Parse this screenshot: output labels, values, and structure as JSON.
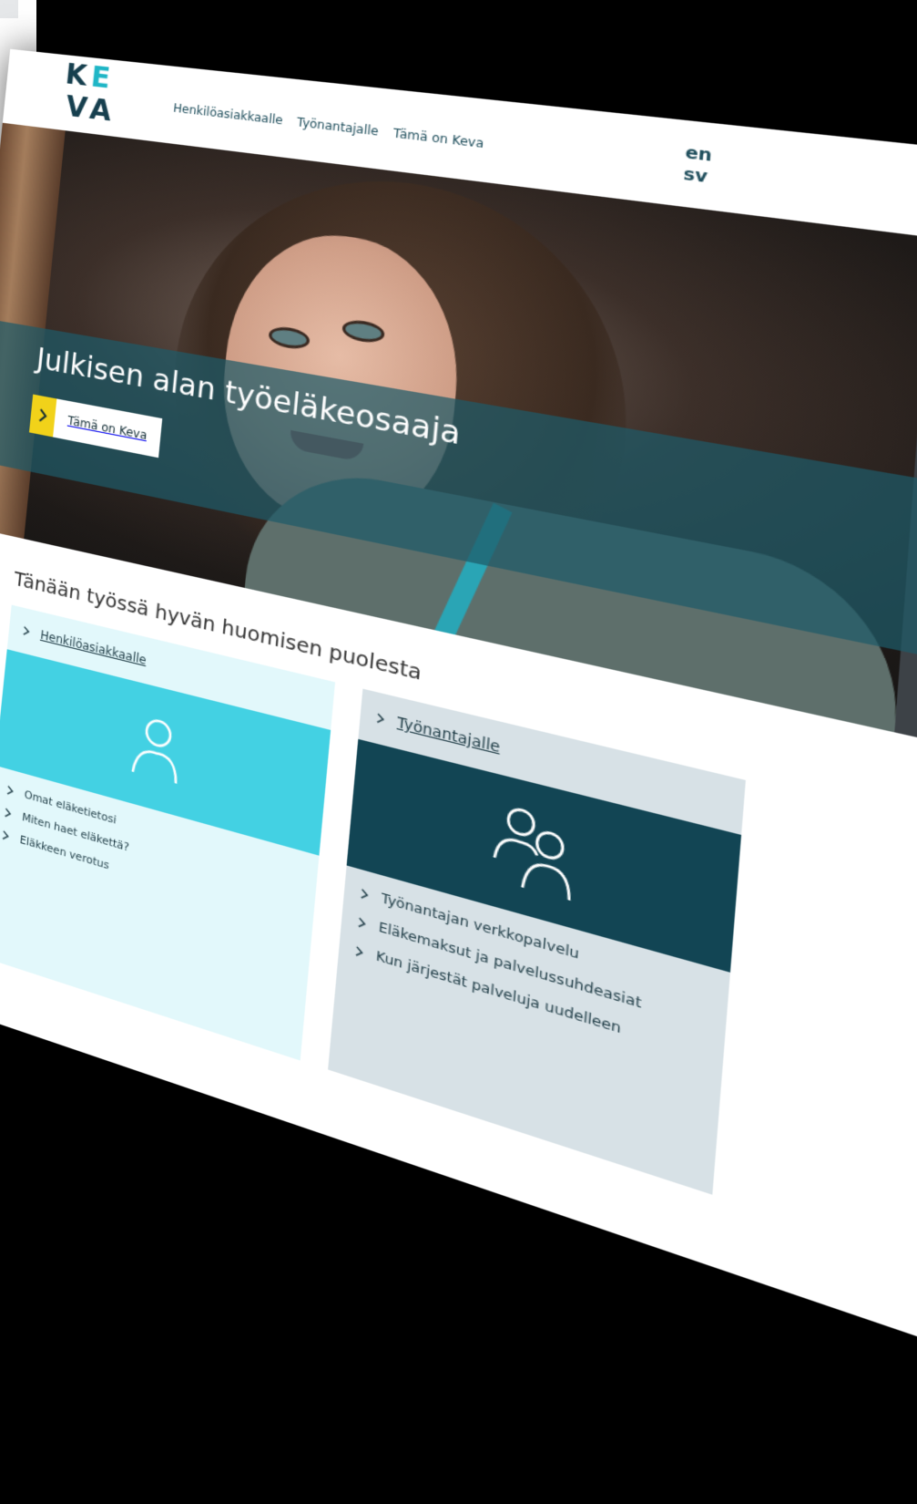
{
  "header": {
    "logo": {
      "letters": [
        "K",
        "E",
        "V",
        "A"
      ],
      "colors": {
        "primary": "#163f4e",
        "accent": "#1fb6c6"
      }
    },
    "nav": [
      "Henkilöasiakkaalle",
      "Työnantajalle",
      "Tämä on Keva"
    ],
    "languages": [
      "en",
      "sv"
    ],
    "search_icon": "search-icon"
  },
  "hero": {
    "title": "Julkisen alan työeläkeosaaja",
    "button_label": "Tämä on Keva",
    "colors": {
      "band": "#1f5a68",
      "button_accent": "#f1d21a"
    }
  },
  "main": {
    "subtitle": "Tänään työssä hyvän huomisen puolesta",
    "cards": [
      {
        "title": "Henkilöasiakkaalle",
        "icon": "person-icon",
        "links": [
          "Omat eläketietosi",
          "Miten haet eläkettä?",
          "Eläkkeen verotus"
        ],
        "colors": {
          "bg": "#e2f8fb",
          "band": "#43d1e3"
        }
      },
      {
        "title": "Työnantajalle",
        "icon": "people-icon",
        "links": [
          "Työnantajan verkkopalvelu",
          "Eläkemaksut ja palvelussuhdeasiat",
          "Kun järjestät palveluja uudelleen"
        ],
        "colors": {
          "bg": "#d7e1e6",
          "band": "#124554"
        }
      }
    ]
  }
}
